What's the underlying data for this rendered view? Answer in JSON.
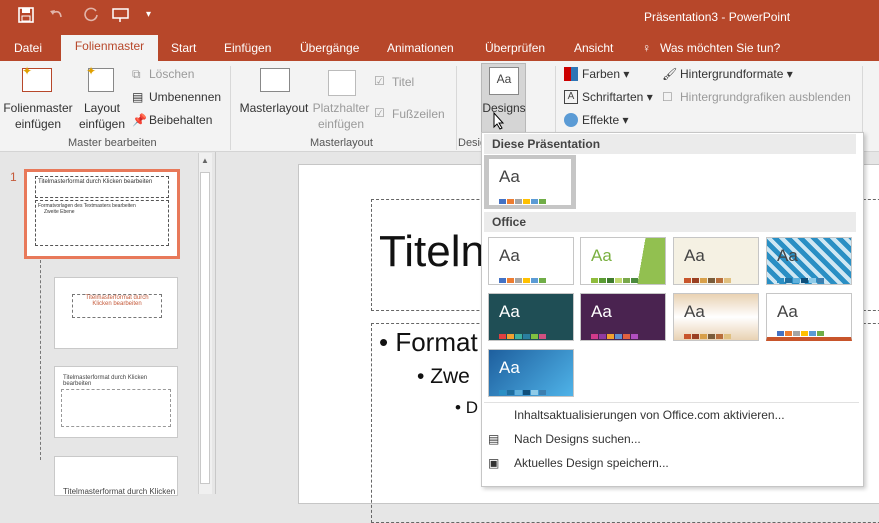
{
  "app_title": "Präsentation3 - PowerPoint",
  "tabs": {
    "datei": "Datei",
    "folienmaster": "Folienmaster",
    "start": "Start",
    "einfuegen": "Einfügen",
    "uebergaenge": "Übergänge",
    "animationen": "Animationen",
    "ueberpruefen": "Überprüfen",
    "ansicht": "Ansicht",
    "tellme": "Was möchten Sie tun?"
  },
  "ribbon": {
    "folienmaster_einfuegen": [
      "Folienmaster",
      "einfügen"
    ],
    "layout_einfuegen": [
      "Layout",
      "einfügen"
    ],
    "loeschen": "Löschen",
    "umbenennen": "Umbenennen",
    "beibehalten": "Beibehalten",
    "group_master": "Master bearbeiten",
    "masterlayout": "Masterlayout",
    "platzhalter": [
      "Platzhalter",
      "einfügen"
    ],
    "titel": "Titel",
    "fusszeilen": "Fußzeilen",
    "group_masterlayout": "Masterlayout",
    "designs": "Designs",
    "group_design": "Desig",
    "farben": "Farben",
    "schriftarten": "Schriftarten",
    "effekte": "Effekte",
    "hintergrundformate": "Hintergrundformate",
    "hintergrundgrafiken": "Hintergrundgrafiken ausblenden"
  },
  "slides": {
    "num": "1",
    "t1": "Titelmasterformat durch Klicken bearbeiten",
    "t2a": "Titelmasterformat durch",
    "t2b": "Klicken bearbeiten",
    "t3": "Titelmasterformat durch Klicken bearbeiten",
    "t4": "Titelmasterformat durch Klicken",
    "body1": "Formatvorlagen des Textmasters bearbeiten",
    "body2": "Zweite Ebene"
  },
  "slide": {
    "title": "Titeln",
    "b1": "Format",
    "b2": "Zwe",
    "b3": "D"
  },
  "dropdown": {
    "sec1": "Diese Präsentation",
    "sec2": "Office",
    "aa": "Aa",
    "m1": "Inhaltsaktualisierungen von Office.com aktivieren...",
    "m2": "Nach Designs suchen...",
    "m3": "Aktuelles Design speichern..."
  },
  "theme_colors": [
    "#4472c4",
    "#ed7d31",
    "#a5a5a5",
    "#ffc000",
    "#5b9bd5",
    "#70ad47"
  ]
}
